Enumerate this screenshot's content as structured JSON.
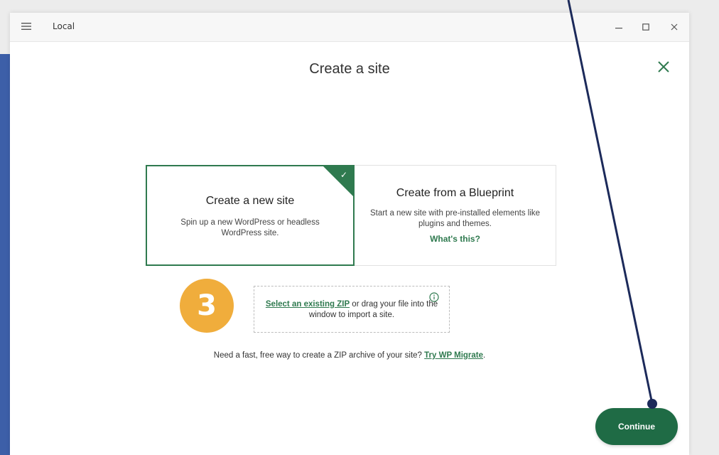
{
  "window": {
    "app_name": "Local",
    "menu_icon": "hamburger-menu-icon",
    "controls": [
      "minimize-icon",
      "maximize-icon",
      "close-icon"
    ]
  },
  "modal": {
    "title": "Create a site",
    "close_icon": "close-icon"
  },
  "options": [
    {
      "title": "Create a new site",
      "description": "Spin up a new WordPress or headless WordPress site.",
      "selected": true
    },
    {
      "title": "Create from a Blueprint",
      "description": "Start a new site with pre-installed elements like plugins and themes.",
      "link": "What's this?",
      "selected": false
    }
  ],
  "zip_import": {
    "link": "Select an existing ZIP",
    "text": " or drag your file into the window to import a site.",
    "icon": "info-icon"
  },
  "footer": {
    "text": "Need a fast, free way to create a ZIP archive of your site? ",
    "link": "Try WP Migrate",
    "suffix": "."
  },
  "continue_label": "Continue",
  "step_badge": "3",
  "colors": {
    "brand_green": "#2f7a4f",
    "button_green": "#1f6b45",
    "badge_orange": "#f0ad3c",
    "pointer_navy": "#1c2a5a",
    "side_blue": "#3d5fa8"
  }
}
